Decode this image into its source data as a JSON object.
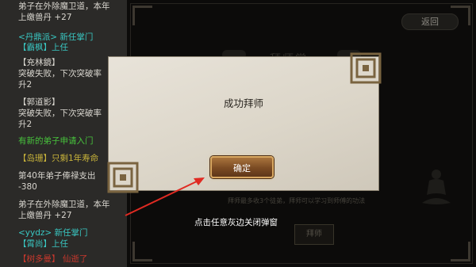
{
  "log": [
    {
      "text": "弟子在外除魔卫道，本年",
      "color": "white"
    },
    {
      "text": "上缴兽丹 +27",
      "color": "white"
    },
    {
      "text": "<丹鼎派> 新任掌门",
      "color": "cyan"
    },
    {
      "text": "【霸枫】上任",
      "color": "cyan"
    },
    {
      "text": "【充林鏡】",
      "color": "white"
    },
    {
      "text": "突破失败，下次突破率",
      "color": "white"
    },
    {
      "text": "升2",
      "color": "white"
    },
    {
      "text": "【郭道影】",
      "color": "white"
    },
    {
      "text": "突破失败，下次突破率",
      "color": "white"
    },
    {
      "text": "升2",
      "color": "white"
    },
    {
      "text": "有新的弟子申请入门",
      "color": "green"
    },
    {
      "text": "【岛珊】只剩1年寿命",
      "color": "yellow"
    },
    {
      "text": "第40年弟子俸禄支出",
      "color": "white"
    },
    {
      "text": "-380",
      "color": "white"
    },
    {
      "text": "弟子在外除魔卫道，本年",
      "color": "white"
    },
    {
      "text": "上缴兽丹 +27",
      "color": "white"
    },
    {
      "text": "<yydz> 新任掌门",
      "color": "cyan"
    },
    {
      "text": "【霄尚】上任",
      "color": "cyan"
    },
    {
      "text": "【树多曼】 仙逝了",
      "color": "red"
    }
  ],
  "stage": {
    "return_label": "返回",
    "title": "拜师堂",
    "hint": "拜师最多收3个徒弟，拜师可以学习到师傅的功法",
    "apprentice_label": "拜师"
  },
  "popup": {
    "message": "成功拜师",
    "confirm_label": "确定"
  },
  "annotation": {
    "text": "点击任意灰边关闭弹窗",
    "arrow_color": "#e02a22"
  },
  "colors": {
    "white": "#d9d6cf",
    "cyan": "#39c7c2",
    "green": "#47c23c",
    "yellow": "#c7b23a",
    "red": "#c7382d"
  }
}
